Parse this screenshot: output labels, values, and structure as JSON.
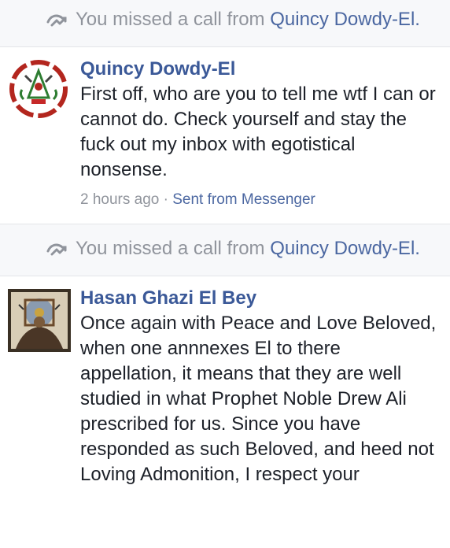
{
  "thread": {
    "missed_call_1": {
      "prefix": "You missed a call from ",
      "name": "Quincy Dowdy-El."
    },
    "message_1": {
      "sender": "Quincy Dowdy-El",
      "text": "First off, who are you to tell me wtf I can or cannot do. Check yourself and stay the fuck out my inbox with egotistical nonsense.",
      "time": "2 hours ago",
      "separator": " · ",
      "source": "Sent from Messenger"
    },
    "missed_call_2": {
      "prefix": "You missed a call from ",
      "name": "Quincy Dowdy-El."
    },
    "message_2": {
      "sender": "Hasan Ghazi El Bey",
      "text": "Once again with Peace and Love Beloved, when one annnexes El to there appellation, it means that they are well studied in what Prophet Noble Drew Ali prescribed for us. Since you have responded as such Beloved, and heed not Loving Admonition, I respect your"
    },
    "icons": {
      "missed_call": "phone-call-arrow-icon",
      "avatar_1": "moorish-emblem-avatar",
      "avatar_2": "profile-photo-avatar"
    },
    "colors": {
      "link": "#3b5998",
      "muted": "#90949c",
      "text": "#1d2129"
    }
  }
}
